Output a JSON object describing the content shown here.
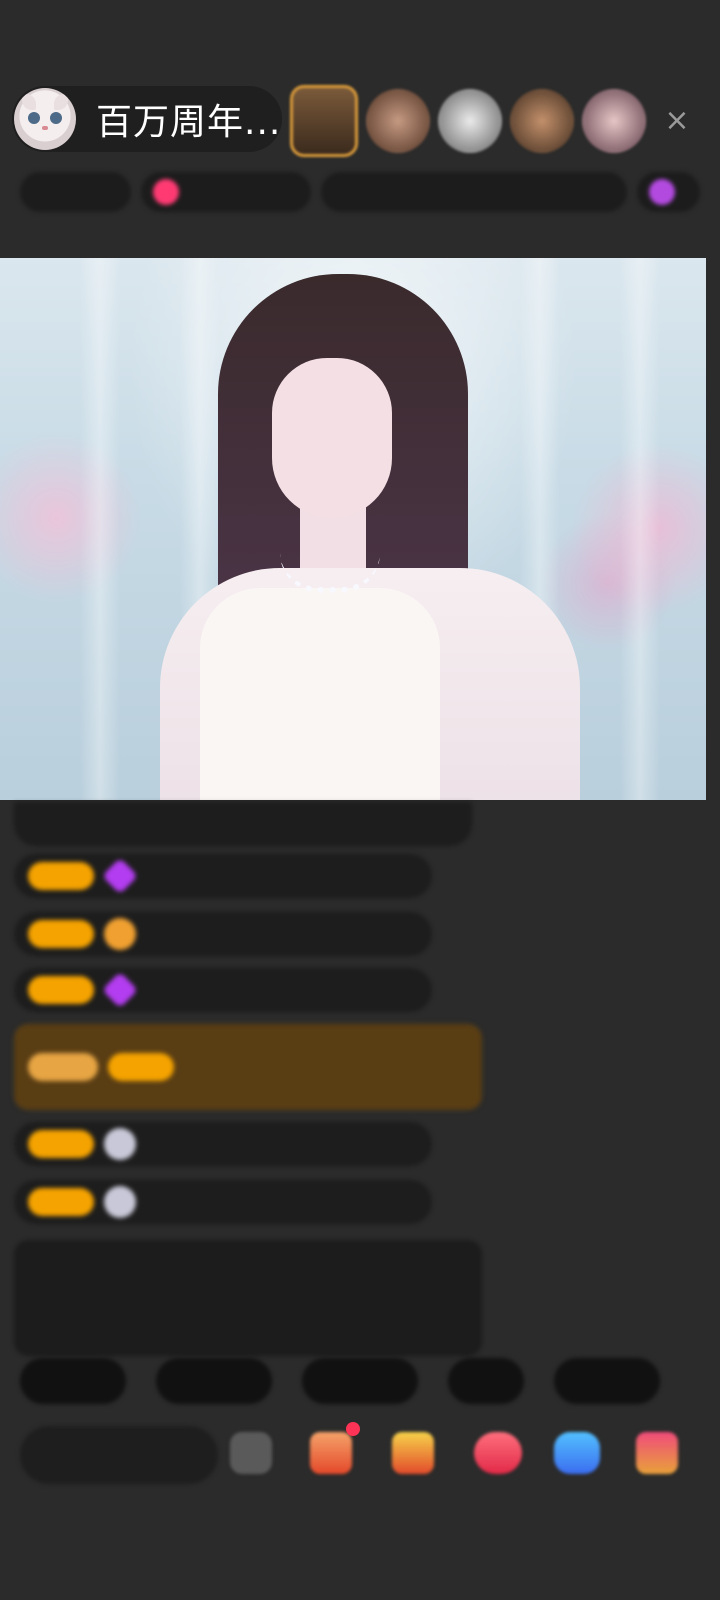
{
  "header": {
    "streamer_name": "百万周年...",
    "close_icon": "×"
  },
  "colors": {
    "background": "#2b2b2b",
    "badge_orange": "#f2a00e",
    "username_purple": "#c497f5",
    "username_gold": "#e9c46a",
    "username_cyan": "#4fc4e8",
    "notice_green": "#9fd56a"
  }
}
